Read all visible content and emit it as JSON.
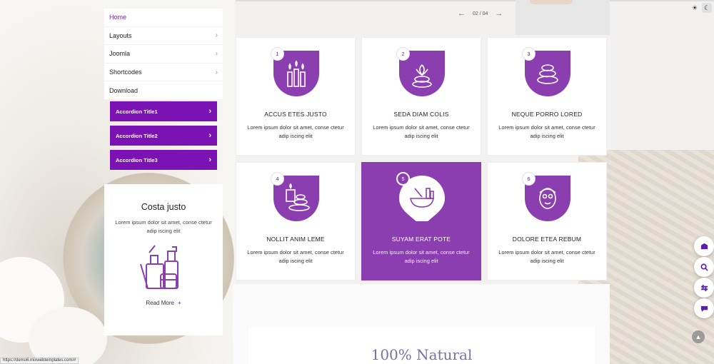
{
  "nav": {
    "items": [
      {
        "label": "Home",
        "active": true
      },
      {
        "label": "Layouts"
      },
      {
        "label": "Joomla"
      },
      {
        "label": "Shortcodes"
      },
      {
        "label": "Download"
      }
    ]
  },
  "accordion": [
    "Accordion Title1",
    "Accordion Title2",
    "Accordion Title3"
  ],
  "product": {
    "title": "Costa justo",
    "text": "Lorem ipsum dolor sit amet, conse ctetur adip iscing elit",
    "read_more": "Read More"
  },
  "pager": {
    "text": "02 / 04"
  },
  "features": [
    {
      "num": "1",
      "title": "ACCUS ETES JUSTO",
      "text": "Lorem ipsum dolor sit amet, conse ctetur adip iscing elit",
      "icon": "candles-icon"
    },
    {
      "num": "2",
      "title": "SEDA DIAM COLIS",
      "text": "Lorem ipsum dolor sit amet, conse ctetur adip iscing elit",
      "icon": "lotus-stones-icon"
    },
    {
      "num": "3",
      "title": "NEQUE PORRO LORED",
      "text": "Lorem ipsum dolor sit amet, conse ctetur adip iscing elit",
      "icon": "stones-icon"
    },
    {
      "num": "4",
      "title": "NOLLIT ANIM LEME",
      "text": "Lorem ipsum dolor sit amet, conse ctetur adip iscing elit",
      "icon": "candle-stones-icon"
    },
    {
      "num": "5",
      "title": "SUYAM ERAT POTE",
      "text": "Lorem ipsum dolor sit amet, conse ctetur adip iscing elit",
      "icon": "mortar-pestle-icon",
      "active": true
    },
    {
      "num": "6",
      "title": "DOLORE ETEA REBUM",
      "text": "Lorem ipsum dolor sit amet, conse ctetur adip iscing elit",
      "icon": "face-mask-icon"
    }
  ],
  "section": {
    "title": "100% Natural"
  },
  "status_url": "https://demo6.mixwebtemplates.com/#",
  "colors": {
    "accent": "#7a12b4",
    "card_active": "#8b3eb0",
    "icon": "#8b3eb0"
  },
  "side_buttons": [
    "cart-icon",
    "search-icon",
    "sliders-icon",
    "chat-icon"
  ]
}
